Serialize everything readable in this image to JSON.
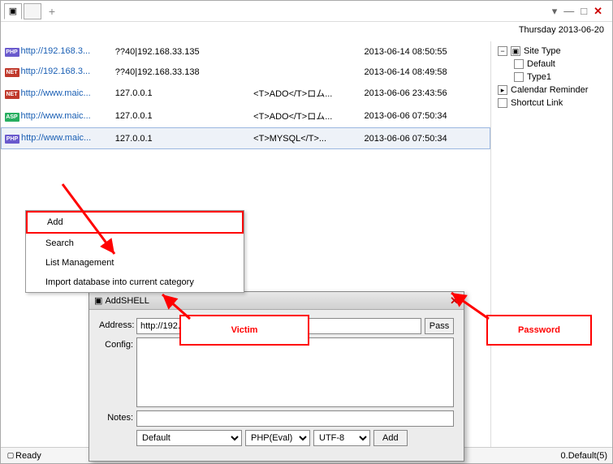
{
  "date": "Thursday 2013-06-20",
  "rows": [
    {
      "badge": "PHP",
      "bc": "b-php",
      "url": "http://192.168.3...",
      "c2": "??40|192.168.33.135",
      "c3": "",
      "c4": "2013-06-14 08:50:55",
      "sel": false
    },
    {
      "badge": "NET",
      "bc": "b-net",
      "url": "http://192.168.3...",
      "c2": "??40|192.168.33.138",
      "c3": "",
      "c4": "2013-06-14 08:49:58",
      "sel": false
    },
    {
      "badge": "NET",
      "bc": "b-net",
      "url": "http://www.maic...",
      "c2": "127.0.0.1",
      "c3": "<T>ADO</T>ロム...",
      "c4": "2013-06-06 23:43:56",
      "sel": false
    },
    {
      "badge": "ASP",
      "bc": "b-asp",
      "url": "http://www.maic...",
      "c2": "127.0.0.1",
      "c3": "<T>ADO</T>ロム...",
      "c4": "2013-06-06 07:50:34",
      "sel": false
    },
    {
      "badge": "PHP",
      "bc": "b-php",
      "url": "http://www.maic...",
      "c2": "127.0.0.1",
      "c3": "<T>MYSQL</T>...",
      "c4": "2013-06-06 07:50:34",
      "sel": true
    }
  ],
  "context_menu": {
    "items": [
      "Add",
      "Search",
      "List Management",
      "Import database into current category"
    ]
  },
  "tree": {
    "root": "Site Type",
    "children": [
      "Default",
      "Type1"
    ],
    "extra": [
      "Calendar Reminder",
      "Shortcut Link"
    ]
  },
  "dialog": {
    "title": "AddSHELL",
    "labels": {
      "address": "Address:",
      "config": "Config:",
      "notes": "Notes:",
      "pass": "Pass"
    },
    "address_value": "http://192.168.33.135/shell.php",
    "selects": {
      "cat": "Default",
      "engine": "PHP(Eval)",
      "charset": "UTF-8"
    },
    "add_btn": "Add"
  },
  "annotations": {
    "victim": "Victim",
    "password": "Password"
  },
  "status": {
    "left": "Ready",
    "right": "0.Default(5)"
  }
}
